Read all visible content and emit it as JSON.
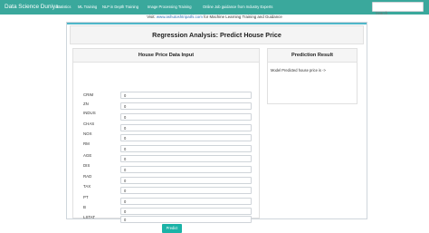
{
  "navbar": {
    "brand": "Data Science Duniya",
    "links": [
      "Statistics",
      "ML Training",
      "NLP in Depth Training",
      "Image Processing Training",
      "Online Job guidance from Industry Experts"
    ],
    "search_placeholder": "Search"
  },
  "announcement": {
    "prefix": "Visit:",
    "link_text": "www.ashutoshtripathi.com",
    "suffix": "for Machine Learning Training and Guidance"
  },
  "main": {
    "title": "Regression Analysis: Predict House Price"
  },
  "form": {
    "title": "House Price Data Input",
    "fields": [
      {
        "label": "CRIM",
        "value": "0"
      },
      {
        "label": "ZN",
        "value": "0"
      },
      {
        "label": "INDUS",
        "value": "0"
      },
      {
        "label": "CHAS",
        "value": "0"
      },
      {
        "label": "NOX",
        "value": "0"
      },
      {
        "label": "RM",
        "value": "0"
      },
      {
        "label": "AGE",
        "value": "0"
      },
      {
        "label": "DIS",
        "value": "0"
      },
      {
        "label": "RAD",
        "value": "0"
      },
      {
        "label": "TAX",
        "value": "0"
      },
      {
        "label": "PT",
        "value": "0"
      },
      {
        "label": "B",
        "value": "0"
      },
      {
        "label": "LSTAT",
        "value": "0"
      }
    ],
    "predict_label": "Predict"
  },
  "result": {
    "title": "Prediction Result",
    "text": "Model Predicted house price is ->"
  }
}
